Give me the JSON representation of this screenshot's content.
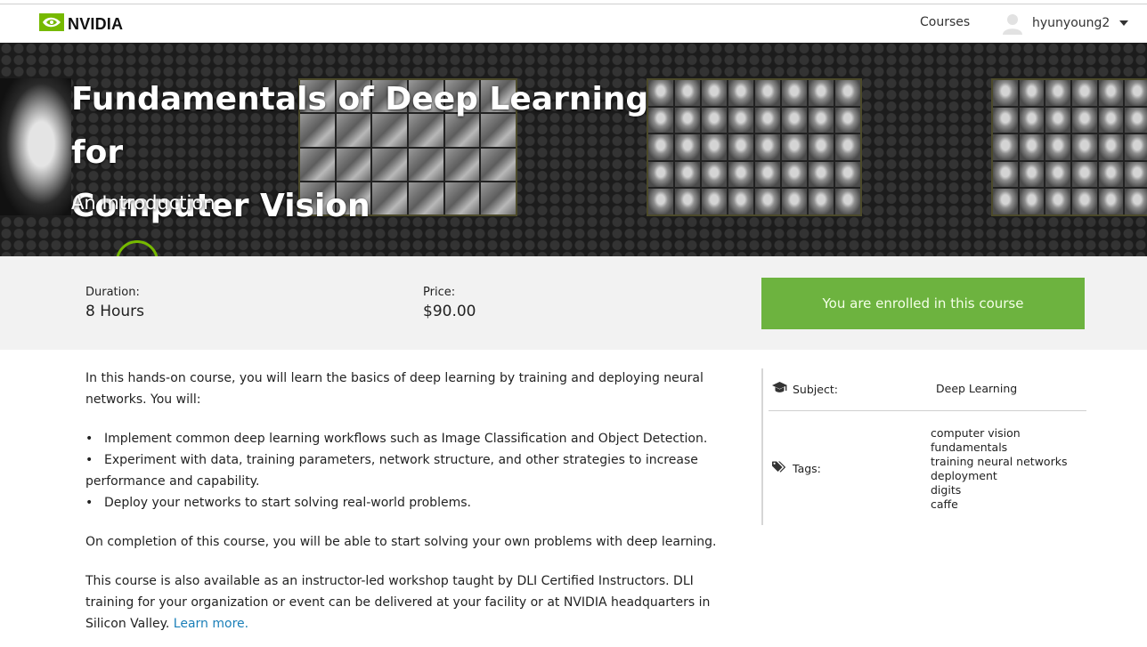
{
  "brand": {
    "name": "NVIDIA",
    "accent": "#76b900"
  },
  "nav": {
    "courses_label": "Courses",
    "username": "hyunyoung2"
  },
  "hero": {
    "title_line1": "Fundamentals of Deep Learning for",
    "title_line2": "Computer Vision",
    "subtitle": "An Introduction"
  },
  "info": {
    "duration_label": "Duration:",
    "duration_value": "8 Hours",
    "price_label": "Price:",
    "price_value": "$90.00",
    "enroll_button": "You are enrolled in this course",
    "enroll_color": "#6db33f"
  },
  "description": {
    "intro": "In this hands-on course, you will learn the basics of deep learning by training and deploying neural networks. You will:",
    "bullets": [
      "Implement common deep learning workflows such as Image Classification and Object Detection.",
      "Experiment with data, training parameters, network structure, and other strategies to increase performance and capability.",
      "Deploy your networks to start solving real-world problems."
    ],
    "completion": "On completion of this course, you will be able to start solving your own problems with deep learning.",
    "workshop": "This course is also available as an instructor-led workshop taught by DLI Certified Instructors. DLI training for your organization or event can be delivered at your facility or at NVIDIA headquarters in Silicon Valley.",
    "learn_more": "Learn more."
  },
  "sidebar": {
    "subject_label": "Subject:",
    "subject_value": "Deep Learning",
    "tags_label": "Tags:",
    "tags": [
      "computer vision",
      "fundamentals",
      "training neural networks",
      "deployment",
      "digits",
      "caffe"
    ]
  },
  "icons": {
    "logo": "nvidia-eye-icon",
    "avatar": "user-avatar-icon",
    "dropdown": "caret-down-icon",
    "subject": "graduation-cap-icon",
    "tags": "tags-icon"
  }
}
